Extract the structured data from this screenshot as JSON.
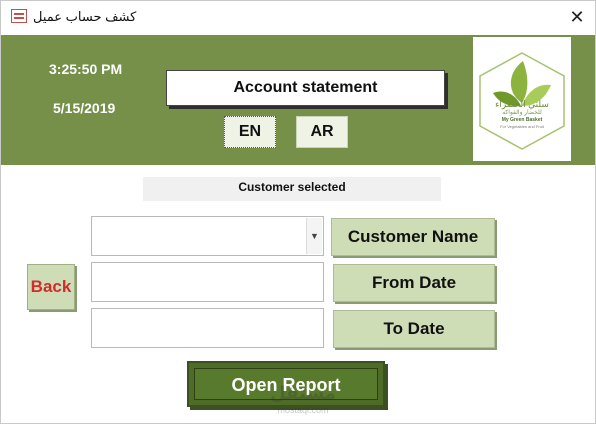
{
  "window": {
    "title": "كشف حساب عميل",
    "close_glyph": "✕"
  },
  "header": {
    "time": "3:25:50 PM",
    "date": "5/15/2019",
    "statement_title": "Account statement",
    "lang_en": "EN",
    "lang_ar": "AR",
    "bg_color": "#76904a"
  },
  "logo": {
    "arabic_name": "سلتي الخضراء",
    "arabic_tagline": "للخضار والفواكه",
    "english_name": "My Green Basket",
    "english_tagline": "For Vegetables and Fruit"
  },
  "form": {
    "customer_selected": "Customer selected",
    "combo_arrow": "▼",
    "customer_name_label": "Customer Name",
    "from_date_label": "From Date",
    "to_date_label": "To Date",
    "back_label": "Back",
    "open_report_label": "Open Report",
    "customer_value": "",
    "from_date_value": "",
    "to_date_value": ""
  },
  "watermark": {
    "arabic": "مستقل",
    "latin": "mostaql.com"
  }
}
